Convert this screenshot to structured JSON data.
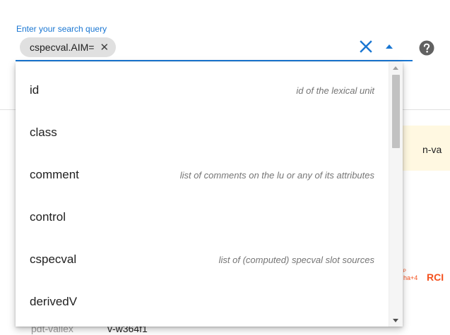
{
  "search": {
    "label": "Enter your search query",
    "chip_text": "cspecval.AIM=",
    "chip_close": "✕"
  },
  "dropdown": {
    "options": [
      {
        "name": "id",
        "description": "id of the lexical unit"
      },
      {
        "name": "class",
        "description": ""
      },
      {
        "name": "comment",
        "description": "list of comments on the lu or any of its attributes"
      },
      {
        "name": "control",
        "description": ""
      },
      {
        "name": "cspecval",
        "description": "list of (computed) specval slot sources"
      },
      {
        "name": "derivedV",
        "description": ""
      }
    ]
  },
  "background": {
    "truncated_label": "n-va",
    "red_small_top": "ᴾ",
    "red_small_bottom": "ha+4",
    "red_big": "RCI",
    "row_label": "pdt-vallex",
    "row_value": "v-w364f1"
  },
  "colors": {
    "accent": "#1976d2",
    "chip_bg": "#e0e0e0",
    "highlight_bg": "#fff8e1",
    "red": "#f4511e"
  },
  "icons": {
    "clear": "close-icon",
    "expand": "caret-up-icon",
    "help": "help-circle-icon"
  }
}
